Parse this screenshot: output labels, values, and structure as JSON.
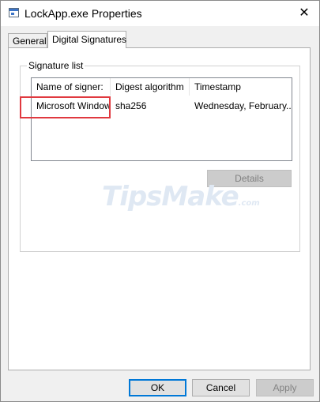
{
  "window": {
    "title": "LockApp.exe Properties",
    "close_glyph": "✕"
  },
  "tabs": [
    {
      "label": "General",
      "active": false
    },
    {
      "label": "Digital Signatures",
      "active": true
    }
  ],
  "signature_group": {
    "label": "Signature list",
    "columns": [
      "Name of signer:",
      "Digest algorithm",
      "Timestamp"
    ],
    "rows": [
      {
        "signer": "Microsoft Windows",
        "digest": "sha256",
        "timestamp": "Wednesday, February..."
      }
    ],
    "details_label": "Details"
  },
  "watermark": {
    "brand": "TipsMake",
    "domain": ".com"
  },
  "footer": {
    "ok_label": "OK",
    "cancel_label": "Cancel",
    "apply_label": "Apply"
  },
  "colors": {
    "highlight": "#e0393f",
    "focus": "#0078d7"
  }
}
